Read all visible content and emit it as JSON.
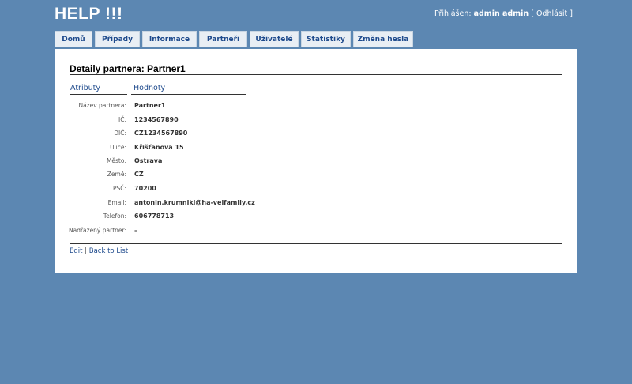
{
  "app": {
    "title": "HELP !!!"
  },
  "login": {
    "prefix": "Přihlášen:",
    "user": "admin admin",
    "bracket_open": "[",
    "logout": "Odhlásit",
    "bracket_close": "]"
  },
  "menu": {
    "items": [
      {
        "label": "Domů"
      },
      {
        "label": "Případy"
      },
      {
        "label": "Informace"
      },
      {
        "label": "Partneři"
      },
      {
        "label": "Uživatelé"
      },
      {
        "label": "Statistiky"
      },
      {
        "label": "Změna hesla"
      }
    ]
  },
  "page": {
    "title": "Detaily partnera: Partner1",
    "col_attr": "Atributy",
    "col_val": "Hodnoty"
  },
  "details": [
    {
      "label": "Název partnera:",
      "value": "Partner1"
    },
    {
      "label": "IČ:",
      "value": "1234567890"
    },
    {
      "label": "DIČ:",
      "value": "CZ1234567890"
    },
    {
      "label": "Ulice:",
      "value": "Křišťanova 15"
    },
    {
      "label": "Město:",
      "value": "Ostrava"
    },
    {
      "label": "Země:",
      "value": "CZ"
    },
    {
      "label": "PSČ:",
      "value": "70200"
    },
    {
      "label": "Email:",
      "value": "antonin.krumnikl@ha-velfamily.cz"
    },
    {
      "label": "Telefon:",
      "value": "606778713"
    },
    {
      "label": "Nadřazený partner:",
      "value": "–"
    }
  ],
  "actions": {
    "edit": "Edit",
    "separator": "|",
    "back": "Back to List"
  }
}
